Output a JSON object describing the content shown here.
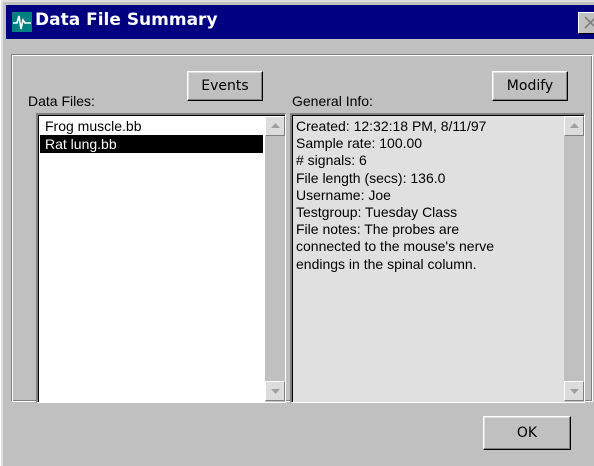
{
  "window": {
    "title": "Data File Summary",
    "icon": "waveform-icon"
  },
  "data_files": {
    "label": "Data Files:",
    "events_button": "Events",
    "items": [
      "Frog muscle.bb",
      "Rat lung.bb"
    ],
    "selected_index": 1
  },
  "general_info": {
    "label": "General Info:",
    "modify_button": "Modify",
    "lines": [
      "Created: 12:32:18 PM, 8/11/97",
      "Sample rate: 100.00",
      "# signals: 6",
      "File length (secs): 136.0",
      "Username: Joe",
      "Testgroup: Tuesday Class",
      "File notes: The probes are",
      "connected to the mouse's nerve",
      "endings in the spinal column."
    ]
  },
  "ok_button": "OK",
  "colors": {
    "titlebar": "#000080",
    "face": "#c0c0c0",
    "info_background": "#e0e0e0",
    "selection": "#000000"
  }
}
